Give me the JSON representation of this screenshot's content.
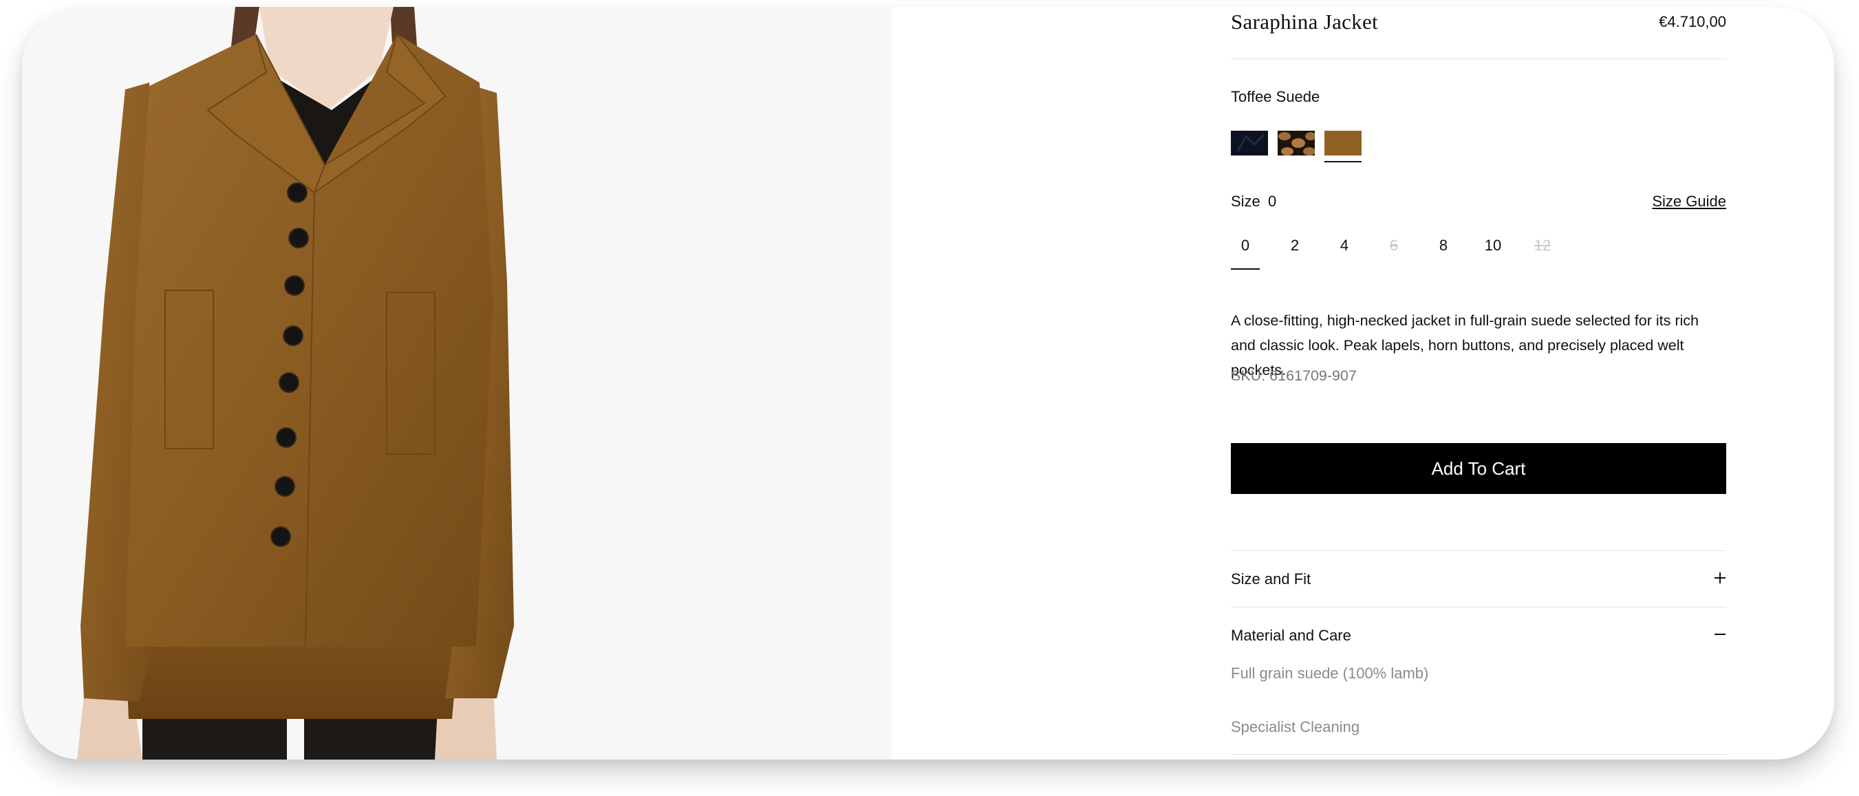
{
  "product": {
    "name": "Saraphina Jacket",
    "price": "€4.710,00",
    "color_name": "Toffee Suede",
    "swatches": [
      {
        "name": "navy",
        "color": "#0c1220"
      },
      {
        "name": "leopard",
        "color": "#9a6a3a"
      },
      {
        "name": "toffee",
        "color": "#8a5c22",
        "selected": true
      }
    ],
    "size_label": "Size",
    "selected_size": "0",
    "size_guide_label": "Size Guide",
    "sizes": [
      "0",
      "2",
      "4",
      "6",
      "8",
      "10",
      "12"
    ],
    "unavailable_sizes": [
      "6",
      "12"
    ],
    "description": "A close-fitting, high-necked jacket in full-grain suede selected for its rich and classic look. Peak lapels, horn buttons, and precisely placed welt pockets.",
    "sku": "SKU: 6161709-907",
    "add_to_cart_label": "Add To Cart"
  },
  "accordion": [
    {
      "label": "Size and Fit",
      "expanded": false,
      "icon": "plus-icon"
    },
    {
      "label": "Material and Care",
      "expanded": true,
      "icon": "minus-icon",
      "content": [
        "Full grain suede (100% lamb)",
        "Specialist Cleaning"
      ]
    }
  ],
  "colors": {
    "accent": "#000000",
    "muted_text": "#8a8a8a",
    "image_background": "#f7f7f7",
    "suede": "#8a5c22"
  }
}
